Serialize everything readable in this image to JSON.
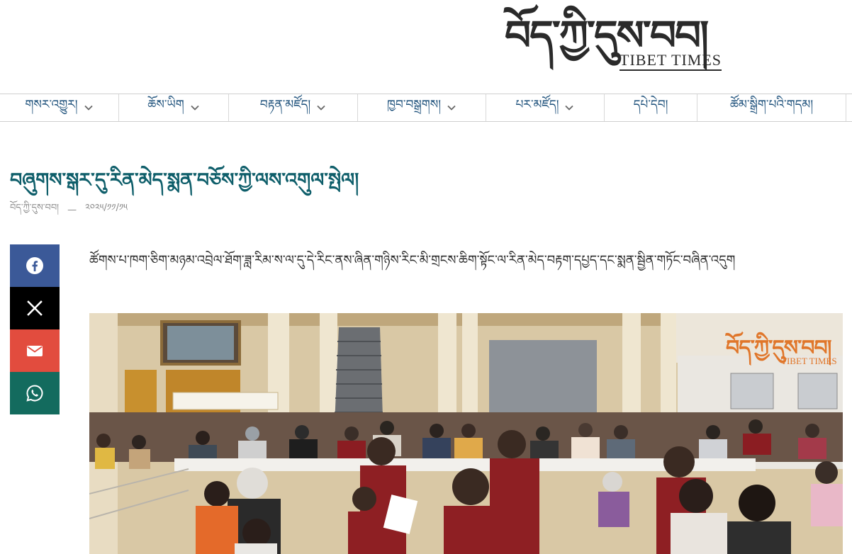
{
  "logo": {
    "tibetan": "བོད་ཀྱི་དུས་བབ།",
    "english": "TIBET TIMES"
  },
  "nav": {
    "items": [
      {
        "label": "གསར་འགྱུར།",
        "has_dropdown": true
      },
      {
        "label": "ཆོས་ཡིག",
        "has_dropdown": true
      },
      {
        "label": "བརྟན་མཛོད།",
        "has_dropdown": true
      },
      {
        "label": "ཁྱབ་བསྒྲགས།",
        "has_dropdown": true
      },
      {
        "label": "པར་མཛོད།",
        "has_dropdown": true
      },
      {
        "label": "དཔེ་དེབ།",
        "has_dropdown": false
      },
      {
        "label": "ཚོམ་སྒྲིག་པའི་གདམ།",
        "has_dropdown": false
      }
    ]
  },
  "article": {
    "title": "བཞུགས་སྒར་དུ་རིན་མེད་སྨན་བཅོས་ཀྱི་ལས་འགུལ་སྤེལ།",
    "author": "བོད་ཀྱི་དུས་བབ།",
    "separator": "—",
    "date": "༢༠༢༥/༡༡/༡༥",
    "lead": "ཚོགས་པ་ཁག་ཅིག་མཉམ་འབྲེལ་ཐོག་ཟླ་རིམ་ས་ལ་དུ་དེ་རིང་ནས་ཞིན་གཉིས་རིང་མི་གྲངས་ཆིག་སྟོང་ལ་རིན་མེད་བརྟག་དཔྱད་དང་སྨན་སྦྱིན་གཏོང་བཞིན་འདུག",
    "photo_watermark": "བོད་ཀྱི་དུས་བབ།",
    "photo_watermark_en": "TIBET TIMES"
  },
  "share": {
    "buttons": [
      {
        "name": "facebook",
        "icon": "facebook-icon",
        "color": "#3b5998"
      },
      {
        "name": "x",
        "icon": "x-icon",
        "color": "#000000"
      },
      {
        "name": "email",
        "icon": "envelope-icon",
        "color": "#e24c3e"
      },
      {
        "name": "whatsapp",
        "icon": "whatsapp-icon",
        "color": "#136b5e"
      }
    ]
  },
  "colors": {
    "title": "#0e5e6a",
    "nav_text": "#1b4f7a",
    "watermark": "#e0762a"
  }
}
